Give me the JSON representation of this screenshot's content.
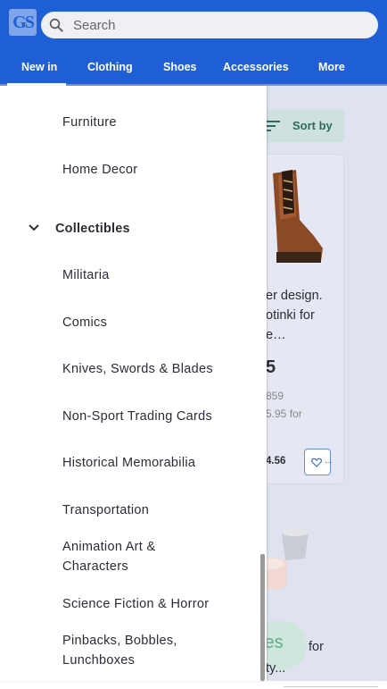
{
  "header": {
    "logo_text": "GS",
    "search_placeholder": "Search",
    "tabs": [
      "New in",
      "Clothing",
      "Shoes",
      "Accessories",
      "More"
    ],
    "active_tab": "New in"
  },
  "toolbar": {
    "sort_label": "Sort by"
  },
  "product": {
    "title": "r design.\notinki for\ne...",
    "price": "5",
    "meta1": "859",
    "meta2": "5.95 for",
    "bid": "4.56",
    "watch_more": "..."
  },
  "product2": {
    "chip_text": "ies",
    "for_text": "for",
    "ty_text": "ty..."
  },
  "drawer": {
    "items_top": [
      "Furniture",
      "Home Decor"
    ],
    "section": "Collectibles",
    "items": [
      "Militaria",
      "Comics",
      "Knives, Swords & Blades",
      "Non-Sport Trading Cards",
      "Historical Memorabilia",
      "Transportation",
      "Animation Art & Characters",
      "Science Fiction & Horror",
      "Pinbacks, Bobbles, Lunchboxes"
    ]
  },
  "colors": {
    "brand_blue": "#1f5fd6",
    "accent_green": "#2e6b5a"
  }
}
